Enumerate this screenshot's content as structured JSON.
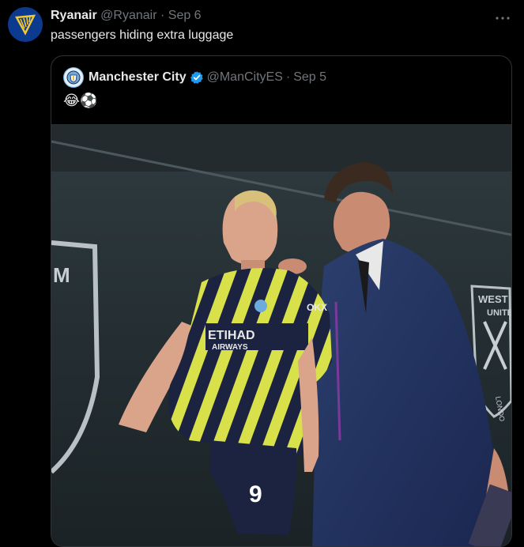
{
  "tweet": {
    "author_name": "Ryanair",
    "handle": "@Ryanair",
    "separator": "·",
    "date": "Sep 6",
    "text": "passengers hiding extra luggage",
    "more_icon": "more-icon"
  },
  "quoted_tweet": {
    "author_name": "Manchester City",
    "handle": "@ManCityES",
    "separator": "·",
    "date": "Sep 5",
    "text": "😂⚽",
    "verified": true
  },
  "media": {
    "jersey_text": "ETIHAD",
    "jersey_sub": "AIRWAYS",
    "shirt_number": "9",
    "crest_text_1": "WEST HA",
    "crest_text_2": "UNITED",
    "crest_text_3": "LONDO",
    "sponsor_text": "OKX",
    "left_wall_text": "M"
  },
  "colors": {
    "background": "#000000",
    "muted": "#71767b",
    "verified": "#1d9bf0",
    "ryanair_blue": "#0b3a8f",
    "ryanair_gold": "#f1c933"
  }
}
